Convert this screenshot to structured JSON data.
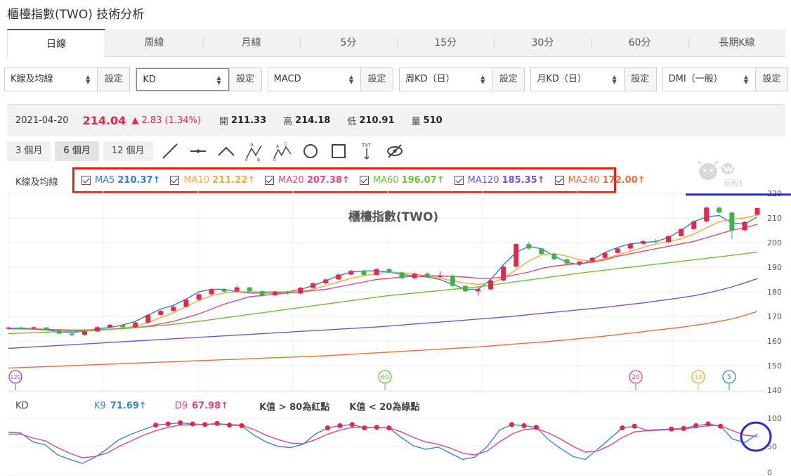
{
  "page_title": "櫃檯指數(TWO) 技術分析",
  "tabs": [
    {
      "label": "日線",
      "active": true
    },
    {
      "label": "周線"
    },
    {
      "label": "月線"
    },
    {
      "label": "5分"
    },
    {
      "label": "15分"
    },
    {
      "label": "30分"
    },
    {
      "label": "60分"
    },
    {
      "label": "長期K線"
    }
  ],
  "selectors": [
    {
      "value": "K線及均線",
      "button": "設定"
    },
    {
      "value": "KD",
      "button": "設定",
      "focused": true
    },
    {
      "value": "MACD",
      "button": "設定"
    },
    {
      "value": "周KD（日）",
      "button": "設定"
    },
    {
      "value": "月KD（日）",
      "button": "設定"
    },
    {
      "value": "DMI（一般）",
      "button": "設定"
    }
  ],
  "quote": {
    "date": "2021-04-20",
    "price": "214.04",
    "change": "▲ 2.83 (1.34%)",
    "open_label": "開",
    "open": "211.33",
    "high_label": "高",
    "high": "214.18",
    "low_label": "低",
    "low": "210.91",
    "volume_label": "量",
    "volume": "510"
  },
  "ranges": [
    "3 個月",
    "6 個月",
    "12 個月"
  ],
  "active_range": "6 個月",
  "tools": [
    "line-tool-icon",
    "horizontal-line-tool-icon",
    "angle-tool-icon",
    "abc-pattern-tool-icon",
    "abcd-pattern-tool-icon",
    "circle-tool-icon",
    "rectangle-tool-icon",
    "text-tool-icon",
    "hide-drawings-icon"
  ],
  "ma_panel_label": "K線及均線",
  "ma_legend": [
    {
      "name": "MA5",
      "value": "210.37↑",
      "color": "#3a7bd5"
    },
    {
      "name": "MA10",
      "value": "211.22↑",
      "color": "#f4a93a"
    },
    {
      "name": "MA20",
      "value": "207.38↑",
      "color": "#e8457a"
    },
    {
      "name": "MA60",
      "value": "196.07↑",
      "color": "#6bbf3a"
    },
    {
      "name": "MA120",
      "value": "185.35↑",
      "color": "#7b4fd8"
    },
    {
      "name": "MA240",
      "value": "172.00↑",
      "color": "#f26b3a"
    }
  ],
  "watermark": "玩股網",
  "kd_legend": {
    "label": "KD",
    "k_name": "K9",
    "k_value": "71.69↑",
    "d_name": "D9",
    "d_value": "67.98↑",
    "rule_red": "K值 > 80為紅點",
    "rule_green": "K值 < 20為綠點"
  },
  "colors": {
    "up": "#e0294b",
    "down": "#3cb44b",
    "k_line": "#3a87d8",
    "d_line": "#e8457a",
    "annotation_box": "#e0221b",
    "annotation_circle": "#2a2ad8"
  },
  "chart_data": [
    {
      "type": "candlestick",
      "title": "櫃檯指數(TWO)",
      "ylim": [
        140,
        222
      ],
      "y_ticks": [
        140,
        150,
        160,
        170,
        180,
        190,
        200,
        210,
        220
      ],
      "ma_markers": [
        "120",
        "60",
        "20",
        "10",
        "5"
      ],
      "series": [
        {
          "name": "MA5",
          "values": [
            165.2,
            165.3,
            165.0,
            164.5,
            163.8,
            163.5,
            164.0,
            165.0,
            165.5,
            166.5,
            168.0,
            170.5,
            173.0,
            174.5,
            177.0,
            180.0,
            181.0,
            181.0,
            180.0,
            179.5,
            179.5,
            179.5,
            180.0,
            181.0,
            182.5,
            184.5,
            186.5,
            188.0,
            188.5,
            188.5,
            188.0,
            187.0,
            186.5,
            186.0,
            185.0,
            183.0,
            181.0,
            181.0,
            185.0,
            191.0,
            196.0,
            198.5,
            197.5,
            194.5,
            192.0,
            191.0,
            193.0,
            196.0,
            198.0,
            199.5,
            200.0,
            200.5,
            202.0,
            205.0,
            208.5,
            210.5,
            211.0,
            208.0,
            207.5,
            210.4
          ]
        },
        {
          "name": "MA10",
          "values": [
            165.0,
            165.0,
            165.0,
            164.8,
            164.5,
            164.2,
            164.0,
            164.2,
            164.8,
            165.3,
            166.0,
            167.5,
            169.5,
            171.5,
            174.0,
            176.5,
            178.5,
            179.5,
            180.0,
            180.0,
            180.0,
            180.0,
            180.0,
            180.0,
            181.0,
            182.5,
            184.0,
            185.5,
            186.5,
            187.5,
            188.0,
            187.8,
            187.2,
            186.5,
            185.5,
            184.5,
            183.5,
            183.0,
            183.5,
            185.5,
            189.0,
            192.5,
            195.0,
            195.5,
            194.5,
            193.0,
            192.5,
            193.5,
            195.0,
            196.5,
            198.0,
            199.5,
            200.5,
            201.5,
            203.5,
            206.0,
            208.5,
            209.5,
            210.0,
            211.2
          ]
        },
        {
          "name": "MA20",
          "values": [
            165.0,
            164.9,
            164.8,
            164.7,
            164.6,
            164.5,
            164.5,
            164.6,
            164.8,
            165.0,
            165.5,
            166.0,
            167.0,
            168.0,
            169.5,
            171.0,
            173.0,
            175.0,
            176.5,
            178.0,
            178.5,
            179.0,
            179.5,
            180.0,
            180.5,
            181.0,
            182.0,
            183.0,
            184.0,
            185.0,
            185.5,
            186.0,
            186.3,
            186.5,
            186.5,
            186.2,
            186.0,
            185.5,
            185.5,
            186.0,
            187.0,
            188.0,
            189.5,
            190.5,
            191.0,
            191.5,
            192.0,
            193.0,
            194.5,
            195.5,
            196.5,
            197.5,
            198.5,
            199.5,
            200.5,
            202.0,
            203.5,
            205.0,
            206.0,
            207.4
          ]
        },
        {
          "name": "MA60",
          "values": [
            163.0,
            163.2,
            163.4,
            163.6,
            163.8,
            164.0,
            164.2,
            164.5,
            164.8,
            165.0,
            165.4,
            165.8,
            166.3,
            166.8,
            167.4,
            168.0,
            168.7,
            169.4,
            170.1,
            170.8,
            171.5,
            172.2,
            172.9,
            173.6,
            174.3,
            175.0,
            175.7,
            176.4,
            177.1,
            177.8,
            178.5,
            179.0,
            179.5,
            180.0,
            180.5,
            181.0,
            181.5,
            182.0,
            182.7,
            183.4,
            184.1,
            184.8,
            185.5,
            186.2,
            186.9,
            187.6,
            188.2,
            188.8,
            189.4,
            190.0,
            190.6,
            191.2,
            191.8,
            192.4,
            193.0,
            193.6,
            194.2,
            194.8,
            195.5,
            196.1
          ]
        },
        {
          "name": "MA120",
          "values": [
            157.0,
            157.3,
            157.6,
            157.9,
            158.2,
            158.5,
            158.8,
            159.1,
            159.4,
            159.7,
            160.0,
            160.3,
            160.6,
            160.9,
            161.2,
            161.5,
            161.8,
            162.1,
            162.4,
            162.7,
            163.0,
            163.3,
            163.6,
            163.9,
            164.2,
            164.5,
            164.8,
            165.1,
            165.4,
            165.7,
            166.1,
            166.5,
            166.9,
            167.3,
            167.7,
            168.1,
            168.5,
            168.9,
            169.3,
            169.7,
            170.2,
            170.7,
            171.2,
            171.7,
            172.2,
            172.7,
            173.2,
            173.7,
            174.3,
            174.9,
            175.5,
            176.2,
            176.9,
            177.6,
            178.4,
            179.4,
            180.6,
            182.0,
            183.6,
            185.35
          ]
        },
        {
          "name": "MA240",
          "values": [
            149.0,
            149.2,
            149.4,
            149.6,
            149.8,
            150.0,
            150.2,
            150.4,
            150.6,
            150.8,
            151.0,
            151.2,
            151.4,
            151.6,
            151.8,
            152.0,
            152.2,
            152.4,
            152.6,
            152.8,
            153.0,
            153.2,
            153.4,
            153.6,
            153.8,
            154.0,
            154.3,
            154.6,
            154.9,
            155.2,
            155.5,
            155.8,
            156.1,
            156.4,
            156.7,
            157.0,
            157.3,
            157.6,
            158.0,
            158.4,
            158.8,
            159.2,
            159.6,
            160.0,
            160.5,
            161.0,
            161.5,
            162.0,
            162.6,
            163.2,
            163.8,
            164.4,
            165.0,
            165.6,
            166.3,
            167.1,
            168.0,
            169.0,
            170.4,
            172.0
          ]
        }
      ],
      "candles": [
        [
          165,
          165.5,
          164.6,
          165.8
        ],
        [
          165.4,
          165.0,
          164.6,
          165.8
        ],
        [
          165.1,
          165.6,
          164.8,
          166.0
        ],
        [
          165.5,
          164.4,
          164.1,
          165.7
        ],
        [
          164.4,
          163.0,
          162.7,
          164.6
        ],
        [
          163.0,
          162.4,
          162.0,
          163.4
        ],
        [
          162.5,
          163.9,
          162.2,
          164.2
        ],
        [
          163.9,
          165.6,
          163.6,
          166.0
        ],
        [
          165.6,
          166.6,
          165.2,
          167.0
        ],
        [
          166.6,
          165.6,
          165.2,
          167.0
        ],
        [
          165.6,
          167.5,
          165.2,
          168.0
        ],
        [
          167.5,
          170.6,
          167.2,
          171.0
        ],
        [
          170.6,
          172.2,
          170.2,
          172.6
        ],
        [
          172.2,
          173.9,
          171.8,
          174.2
        ],
        [
          173.9,
          176.8,
          173.6,
          177.2
        ],
        [
          176.8,
          179.0,
          176.4,
          179.4
        ],
        [
          179.0,
          181.0,
          178.6,
          181.4
        ],
        [
          181.0,
          180.1,
          179.6,
          181.4
        ],
        [
          180.1,
          181.8,
          179.6,
          182.6
        ],
        [
          181.8,
          180.2,
          179.6,
          182.0
        ],
        [
          180.2,
          178.6,
          178.2,
          180.6
        ],
        [
          178.6,
          180.1,
          178.2,
          180.5
        ],
        [
          180.1,
          179.3,
          178.8,
          180.4
        ],
        [
          179.3,
          181.6,
          179.0,
          182.0
        ],
        [
          181.6,
          183.5,
          181.2,
          183.9
        ],
        [
          183.5,
          185.0,
          183.0,
          185.4
        ],
        [
          185.0,
          187.0,
          184.6,
          187.4
        ],
        [
          187.0,
          188.5,
          186.6,
          189.0
        ],
        [
          188.5,
          186.8,
          186.4,
          189.0
        ],
        [
          186.8,
          189.2,
          186.4,
          189.6
        ],
        [
          189.2,
          187.8,
          187.4,
          189.6
        ],
        [
          187.8,
          185.5,
          185.0,
          188.2
        ],
        [
          185.5,
          187.4,
          185.0,
          187.8
        ],
        [
          187.4,
          186.0,
          185.6,
          188.0
        ],
        [
          186.0,
          186.6,
          185.6,
          188.4
        ],
        [
          186.6,
          182.4,
          182.0,
          187.0
        ],
        [
          182.4,
          180.2,
          179.8,
          182.6
        ],
        [
          180.2,
          181.0,
          178.4,
          181.6
        ],
        [
          181.0,
          184.6,
          180.6,
          185.0
        ],
        [
          184.6,
          190.2,
          184.2,
          190.6
        ],
        [
          190.2,
          199.4,
          189.8,
          199.8
        ],
        [
          199.4,
          197.6,
          197.2,
          200.2
        ],
        [
          197.6,
          195.4,
          195.0,
          198.0
        ],
        [
          195.4,
          193.2,
          192.8,
          196.0
        ],
        [
          193.2,
          191.5,
          191.0,
          193.6
        ],
        [
          191.5,
          192.3,
          190.5,
          192.7
        ],
        [
          192.3,
          193.8,
          192.0,
          194.2
        ],
        [
          193.8,
          195.8,
          193.5,
          196.3
        ],
        [
          195.8,
          197.6,
          195.4,
          198.0
        ],
        [
          197.6,
          199.5,
          197.2,
          199.9
        ],
        [
          199.5,
          200.6,
          199.1,
          201.0
        ],
        [
          200.6,
          200.2,
          199.8,
          201.4
        ],
        [
          200.2,
          202.6,
          199.8,
          203.0
        ],
        [
          202.6,
          205.5,
          202.2,
          205.9
        ],
        [
          205.5,
          208.6,
          205.1,
          209.0
        ],
        [
          208.6,
          214.2,
          208.2,
          214.6
        ],
        [
          214.2,
          212.2,
          211.6,
          214.6
        ],
        [
          212.2,
          205.0,
          201.4,
          212.6
        ],
        [
          205.0,
          208.4,
          204.6,
          208.8
        ],
        [
          211.3,
          214.04,
          210.91,
          214.18
        ]
      ]
    },
    {
      "type": "line",
      "title": "KD",
      "ylim": [
        0,
        100
      ],
      "y_ticks": [
        0,
        50,
        100
      ],
      "series": [
        {
          "name": "K9",
          "values": [
            75,
            74,
            58,
            53,
            35,
            27,
            20,
            30,
            45,
            62,
            72,
            80,
            88,
            90,
            92,
            90,
            89,
            91,
            88,
            87,
            70,
            58,
            50,
            48,
            54,
            72,
            83,
            87,
            89,
            83,
            84,
            83,
            66,
            51,
            45,
            49,
            38,
            27,
            31,
            50,
            79,
            89,
            87,
            84,
            62,
            46,
            32,
            27,
            45,
            64,
            83,
            86,
            79,
            80,
            81,
            82,
            87,
            90,
            86,
            63,
            57,
            72
          ]
        },
        {
          "name": "D9",
          "values": [
            72,
            72,
            65,
            60,
            48,
            38,
            30,
            32,
            38,
            50,
            60,
            70,
            78,
            84,
            88,
            89,
            89,
            90,
            89,
            88,
            80,
            70,
            62,
            56,
            55,
            62,
            72,
            79,
            84,
            84,
            84,
            83,
            76,
            66,
            58,
            54,
            47,
            38,
            35,
            42,
            58,
            72,
            80,
            82,
            74,
            63,
            50,
            40,
            42,
            52,
            66,
            76,
            78,
            79,
            80,
            81,
            84,
            87,
            87,
            78,
            70,
            68
          ]
        }
      ]
    }
  ]
}
